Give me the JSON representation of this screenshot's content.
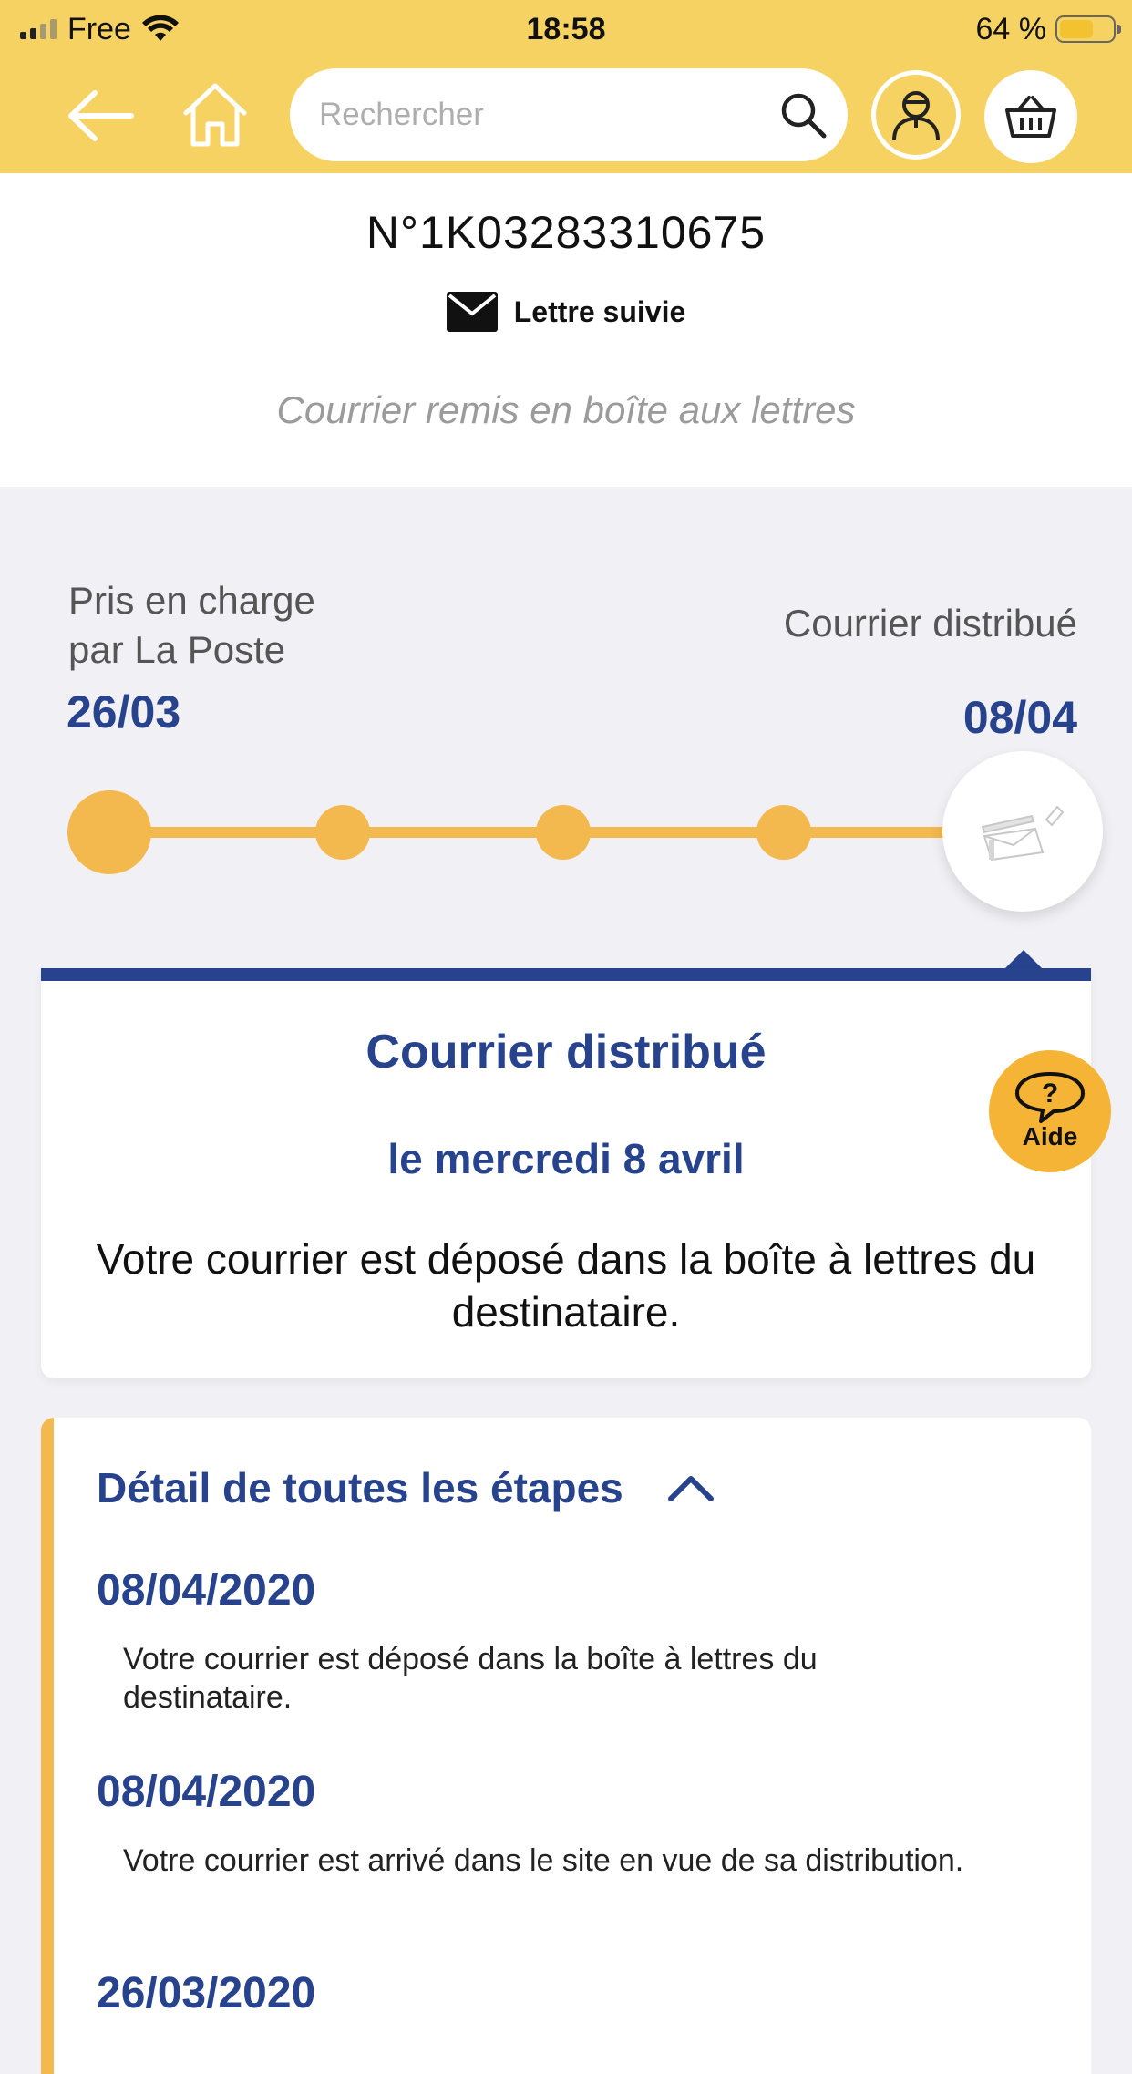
{
  "status_bar": {
    "carrier": "Free",
    "time": "18:58",
    "battery_percent": "64 %",
    "battery_level": 0.64
  },
  "header": {
    "search_placeholder": "Rechercher",
    "icons": [
      "back-arrow-icon",
      "home-icon",
      "search-icon",
      "account-icon",
      "basket-icon"
    ]
  },
  "tracking": {
    "number": "N°1K03283310675",
    "type_label": "Lettre suivie",
    "type_icon": "envelope-icon",
    "status_summary": "Courrier remis en boîte aux lettres"
  },
  "timeline": {
    "start_label_line1": "Pris en charge",
    "start_label_line2": "par La Poste",
    "start_date": "26/03",
    "end_label": "Courrier distribué",
    "end_date": "08/04",
    "steps_total": 5,
    "steps_completed": 5
  },
  "status_card": {
    "title": "Courrier distribué",
    "date": "le mercredi 8 avril",
    "description": "Votre courrier est déposé dans la boîte à lettres du destinataire."
  },
  "aide": {
    "label": "Aide",
    "icon": "help-bubble-icon"
  },
  "details": {
    "title": "Détail de toutes les étapes",
    "expanded": true,
    "steps": [
      {
        "date": "08/04/2020",
        "text": "Votre courrier est déposé dans la boîte à lettres du destinataire."
      },
      {
        "date": "08/04/2020",
        "text": "Votre courrier est arrivé dans le site en vue de sa distribution."
      },
      {
        "date": "26/03/2020",
        "text": ""
      }
    ]
  },
  "colors": {
    "header_yellow": "#f6d262",
    "accent_orange": "#f3b84e",
    "navy": "#28438d",
    "aide_orange": "#f5b436"
  }
}
